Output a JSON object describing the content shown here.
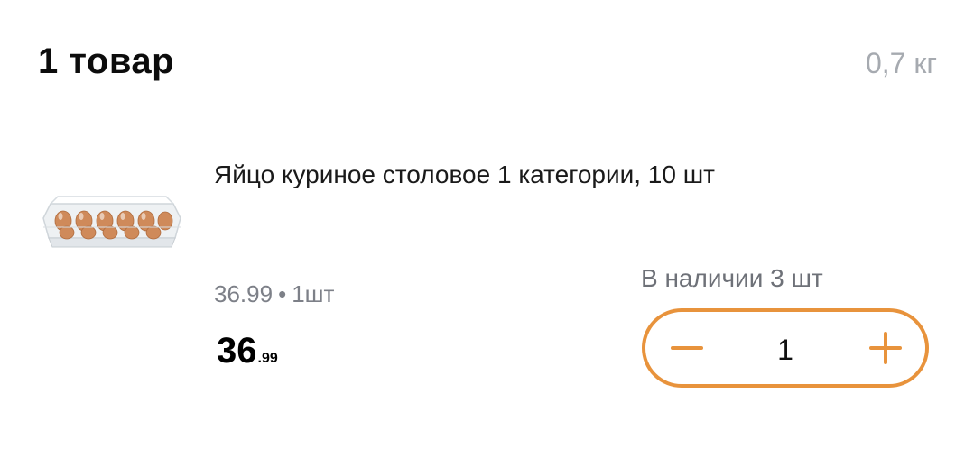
{
  "header": {
    "title": "1 товар",
    "weight": "0,7 кг"
  },
  "product": {
    "image_icon": "egg-carton-image",
    "name": "Яйцо куриное столовое 1 категории, 10 шт",
    "unit_price": "36.99",
    "unit_separator": "•",
    "unit": "1шт",
    "price_main": "36",
    "price_cents": ".99",
    "stock": "В наличии 3 шт"
  },
  "stepper": {
    "value": "1",
    "minus_icon": "minus-icon",
    "plus_icon": "plus-icon",
    "accent_color": "#e8933c"
  }
}
